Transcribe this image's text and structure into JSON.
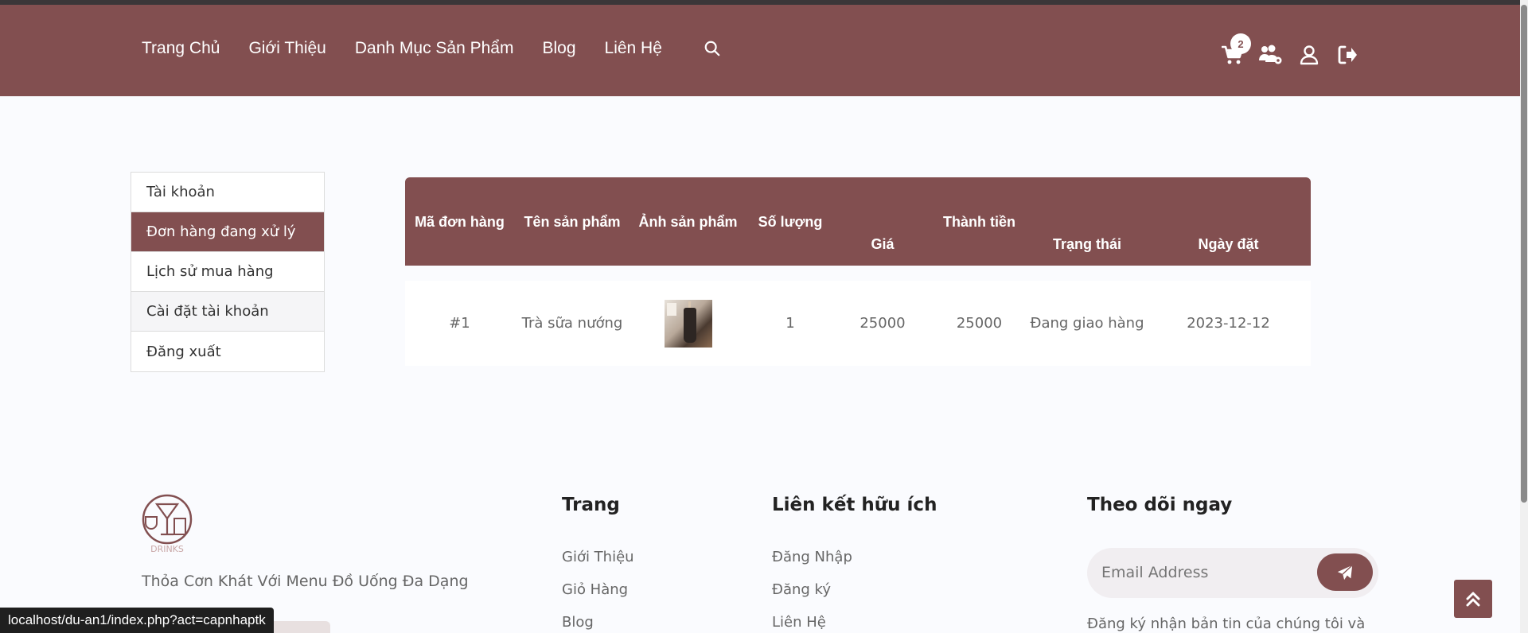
{
  "nav": {
    "items": [
      "Trang Chủ",
      "Giới Thiệu",
      "Danh Mục Sản Phẩm",
      "Blog",
      "Liên Hệ"
    ],
    "search_icon": "search-icon"
  },
  "header_icons": {
    "cart_count": "2",
    "icons": [
      "cart-icon",
      "users-gear-icon",
      "user-icon",
      "logout-icon"
    ]
  },
  "sidebar": {
    "items": [
      {
        "label": "Tài khoản"
      },
      {
        "label": "Đơn hàng đang xử lý"
      },
      {
        "label": "Lịch sử mua hàng"
      },
      {
        "label": "Cài đặt tài khoản"
      },
      {
        "label": "Đăng xuất"
      }
    ],
    "active_index": 1
  },
  "orders": {
    "headers": [
      "Mã đơn hàng",
      "Tên sản phẩm",
      "Ảnh sản phẩm",
      "Số lượng",
      "Giá",
      "Thành tiền",
      "Trạng thái",
      "Ngày đặt"
    ],
    "rows": [
      {
        "id": "#1",
        "product": "Trà sữa nướng",
        "qty": "1",
        "price": "25000",
        "total": "25000",
        "status": "Đang giao hàng",
        "date": "2023-12-12"
      }
    ]
  },
  "footer": {
    "logo_text": "DRINKS",
    "tagline": "Thỏa Cơn Khát Với Menu Đồ Uống Đa Dạng",
    "col_pages": {
      "title": "Trang",
      "links": [
        "Giới Thiệu",
        "Giỏ Hàng",
        "Blog"
      ]
    },
    "col_links": {
      "title": "Liên kết hữu ích",
      "links": [
        "Đăng Nhập",
        "Đăng ký",
        "Liên Hệ"
      ]
    },
    "col_follow": {
      "title": "Theo dõi ngay",
      "email_placeholder": "Email Address",
      "subtext": "Đăng ký nhận bản tin của chúng tôi và"
    }
  },
  "status_url": "localhost/du-an1/index.php?act=capnhaptk",
  "colors": {
    "brand": "#824f50",
    "background": "#fafbfe"
  }
}
